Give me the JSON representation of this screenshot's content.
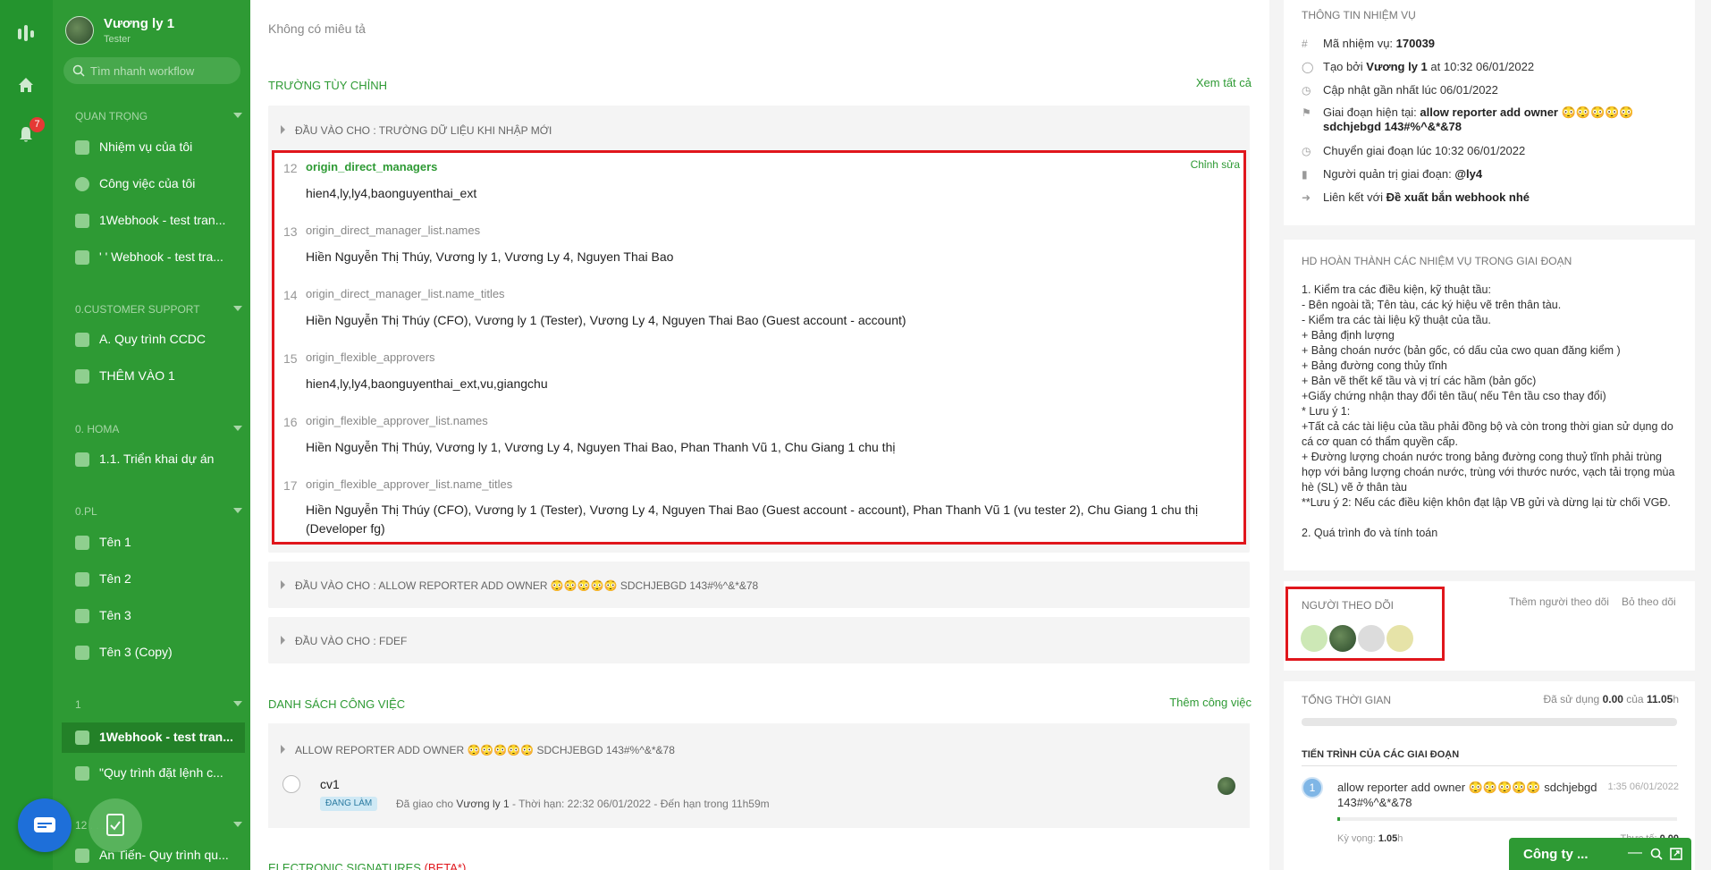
{
  "sidebar": {
    "notification_count": "7",
    "user_name": "Vương ly 1",
    "user_role": "Tester",
    "search_placeholder": "Tìm nhanh workflow",
    "sections": [
      {
        "title": "QUAN TRỌNG",
        "items": [
          "Nhiệm vụ của tôi",
          "Công việc của tôi",
          "1Webhook - test tran...",
          "' ' Webhook - test tra..."
        ]
      },
      {
        "title": "0.CUSTOMER SUPPORT",
        "items": [
          "A. Quy trình CCDC",
          "THÊM VÀO 1"
        ]
      },
      {
        "title": "0. HOMA",
        "items": [
          "1.1. Triển khai dự án"
        ]
      },
      {
        "title": "0.PL",
        "items": [
          "Tên 1",
          "Tên 2",
          "Tên 3",
          "Tên 3 (Copy)"
        ]
      },
      {
        "title": "1",
        "items": [
          "1Webhook - test tran...",
          "\"Quy trình đặt lệnh c..."
        ]
      },
      {
        "title": "12 . . . 1",
        "items": [
          "An Tiến- Quy trình qu..."
        ]
      }
    ]
  },
  "main": {
    "description": "Không có miêu tả",
    "custom_fields_title": "TRƯỜNG TÙY CHỈNH",
    "view_all": "Xem tất cả",
    "group1_title": "ĐẦU VÀO CHO : TRƯỜNG DỮ LIỆU KHI NHẬP MỚI",
    "edit_label": "Chỉnh sửa",
    "fields": [
      {
        "num": "12",
        "key": "origin_direct_managers",
        "value": "hien4,ly,ly4,baonguyenthai_ext"
      },
      {
        "num": "13",
        "key": "origin_direct_manager_list.names",
        "value": "Hiền Nguyễn Thị Thúy, Vương ly 1, Vương Ly 4, Nguyen Thai Bao"
      },
      {
        "num": "14",
        "key": "origin_direct_manager_list.name_titles",
        "value": "Hiền Nguyễn Thị Thúy (CFO), Vương ly 1 (Tester), Vương Ly 4, Nguyen Thai Bao (Guest account - account)"
      },
      {
        "num": "15",
        "key": "origin_flexible_approvers",
        "value": "hien4,ly,ly4,baonguyenthai_ext,vu,giangchu"
      },
      {
        "num": "16",
        "key": "origin_flexible_approver_list.names",
        "value": "Hiền Nguyễn Thị Thúy, Vương ly 1, Vương Ly 4, Nguyen Thai Bao, Phan Thanh Vũ 1, Chu Giang 1 chu thị"
      },
      {
        "num": "17",
        "key": "origin_flexible_approver_list.name_titles",
        "value": "Hiền Nguyễn Thị Thúy (CFO), Vương ly 1 (Tester), Vương Ly 4, Nguyen Thai Bao (Guest account - account), Phan Thanh Vũ 1 (vu tester 2), Chu Giang 1 chu thị (Developer fg)"
      }
    ],
    "group2_title": "ĐẦU VÀO CHO : ALLOW REPORTER ADD OWNER 😳😳😳😳😳 SDCHJEBGD 143#%^&*&78",
    "group3_title": "ĐẦU VÀO CHO : FDEF",
    "task_list_title": "DANH SÁCH CÔNG VIỆC",
    "add_task": "Thêm công việc",
    "task_group_title": "ALLOW REPORTER ADD OWNER 😳😳😳😳😳 SDCHJEBGD 143#%^&*&78",
    "task_name": "cv1",
    "task_status": "ĐANG LÀM",
    "task_meta_prefix": "Đã giao cho ",
    "task_meta_user": "Vương ly 1",
    "task_meta_suffix": " - Thời hạn: 22:32 06/01/2022 - Đến hạn trong 11h59m",
    "signatures_title": "ELECTRONIC SIGNATURES",
    "signatures_beta": "(BETA*)"
  },
  "right": {
    "info_title": "THÔNG TIN NHIỆM VỤ",
    "task_id_label": "Mã nhiệm vụ: ",
    "task_id": "170039",
    "created_prefix": "Tạo bởi ",
    "created_by": "Vương ly 1",
    "created_suffix": " at 10:32 06/01/2022",
    "updated": "Cập nhật gần nhất lúc 06/01/2022",
    "stage_label": "Giai đoạn hiện tại: ",
    "stage_value_line1": "allow reporter add owner 😳😳😳😳😳",
    "stage_value_line2": "sdchjebgd 143#%^&*&78",
    "moved": "Chuyển giai đoạn lúc 10:32 06/01/2022",
    "admin_label": "Người quản trị giai đoạn: ",
    "admin_value": "@ly4",
    "link_label": "Liên kết với ",
    "link_value": "Đề xuất bắn webhook nhé",
    "hd_title": "HD HOÀN THÀNH CÁC NHIỆM VỤ TRONG GIAI ĐOẠN",
    "hd_text": "1. Kiểm tra các điều kiện, kỹ thuật tầu:\n- Bên ngoài tầ; Tên tàu, các ký hiệu vẽ trên thân tàu.\n- Kiểm tra các tài liệu kỹ thuật của tầu.\n+ Bảng định lượng\n+ Bảng choán nước (bản gốc, có dấu của cwo quan đăng kiểm )\n+ Bảng đường cong thủy tĩnh\n+ Bản vẽ thết kế tầu và vị trí các hầm (bản gốc)\n+Giấy chứng nhận thay đổi tên tầu( nếu Tên tầu cso thay đổi)\n* Lưu ý 1:\n+Tất cả các tài liệu của tầu phải đồng bộ và còn trong thời gian sử dụng do cá cơ quan có thẩm quyền cấp.\n+ Đường lượng choán nước trong bảng đường cong thuỷ tĩnh phải trùng hợp với bảng lượng choán nước, trùng với thước nước, vạch tải trọng mùa hè (SL) vẽ ở thân tàu\n**Lưu ý 2: Nếu các điều kiện khôn đạt lập VB gửi và dừng lại từ chối VGĐ.\n\n2. Quá trình đo và tính toán",
    "followers_title": "NGƯỜI THEO DÕI",
    "add_follower": "Thêm người theo dõi",
    "unfollow": "Bỏ theo dõi",
    "total_time_title": "TỔNG THỜI GIAN",
    "used_prefix": "Đã sử dụng ",
    "used_value": "0.00",
    "used_mid": " của ",
    "used_total": "11.05",
    "used_unit": "h",
    "stage_progress_title": "TIẾN TRÌNH CỦA CÁC GIAI ĐOẠN",
    "stage_index": "1",
    "stage_name_line1": "allow reporter add owner 😳😳😳😳😳 sdchjebgd",
    "stage_name_line2": "143#%^&*&78",
    "stage_time": "1:35 06/01/2022",
    "expected_label": "Kỳ vọng: ",
    "expected_value": "1.05",
    "expected_unit": "h",
    "actual_label": "Thực tế: ",
    "actual_value": "0.00",
    "progress_fraction": 0
  },
  "chat": {
    "title": "Công ty ..."
  }
}
